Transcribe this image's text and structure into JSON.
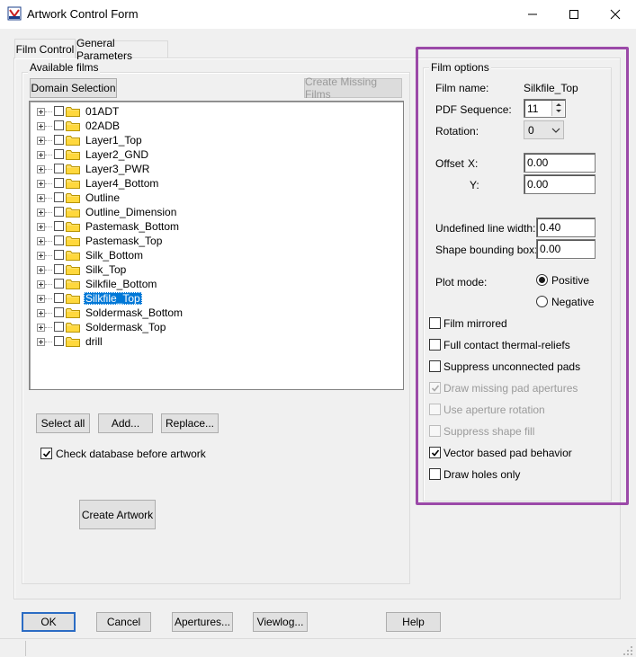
{
  "window": {
    "title": "Artwork Control Form",
    "accent_color": "#0078d7",
    "highlight_color": "#9b49a8"
  },
  "tabs": [
    {
      "label": "Film Control",
      "active": true
    },
    {
      "label": "General Parameters",
      "active": false
    }
  ],
  "available_films": {
    "group_label": "Available films",
    "domain_selection_label": "Domain Selection",
    "create_missing_films_label": "Create Missing Films",
    "films": [
      {
        "name": "01ADT",
        "selected": false
      },
      {
        "name": "02ADB",
        "selected": false
      },
      {
        "name": "Layer1_Top",
        "selected": false
      },
      {
        "name": "Layer2_GND",
        "selected": false
      },
      {
        "name": "Layer3_PWR",
        "selected": false
      },
      {
        "name": "Layer4_Bottom",
        "selected": false
      },
      {
        "name": "Outline",
        "selected": false
      },
      {
        "name": "Outline_Dimension",
        "selected": false
      },
      {
        "name": "Pastemask_Bottom",
        "selected": false
      },
      {
        "name": "Pastemask_Top",
        "selected": false
      },
      {
        "name": "Silk_Bottom",
        "selected": false
      },
      {
        "name": "Silk_Top",
        "selected": false
      },
      {
        "name": "Silkfile_Bottom",
        "selected": false
      },
      {
        "name": "Silkfile_Top",
        "selected": true
      },
      {
        "name": "Soldermask_Bottom",
        "selected": false
      },
      {
        "name": "Soldermask_Top",
        "selected": false
      },
      {
        "name": "drill",
        "selected": false
      }
    ],
    "select_all_label": "Select all",
    "add_label": "Add...",
    "replace_label": "Replace...",
    "check_database_label": "Check database before artwork",
    "check_database_checked": true,
    "create_artwork_label": "Create Artwork"
  },
  "film_options": {
    "group_label": "Film options",
    "film_name_label": "Film name:",
    "film_name_value": "Silkfile_Top",
    "pdf_sequence_label": "PDF Sequence:",
    "pdf_sequence_value": "11",
    "rotation_label": "Rotation:",
    "rotation_value": "0",
    "offset_label": "Offset",
    "offset_x_label": "X:",
    "offset_x_value": "0.00",
    "offset_y_label": "Y:",
    "offset_y_value": "0.00",
    "undefined_line_width_label": "Undefined line width:",
    "undefined_line_width_value": "0.40",
    "shape_bounding_box_label": "Shape bounding box:",
    "shape_bounding_box_value": "0.00",
    "plot_mode_label": "Plot mode:",
    "plot_mode_positive_label": "Positive",
    "plot_mode_negative_label": "Negative",
    "plot_mode_value": "Positive",
    "options": [
      {
        "label": "Film mirrored",
        "checked": false,
        "enabled": true
      },
      {
        "label": "Full contact thermal-reliefs",
        "checked": false,
        "enabled": true
      },
      {
        "label": "Suppress unconnected pads",
        "checked": false,
        "enabled": true
      },
      {
        "label": "Draw missing pad apertures",
        "checked": true,
        "enabled": false
      },
      {
        "label": "Use aperture rotation",
        "checked": false,
        "enabled": false
      },
      {
        "label": "Suppress shape fill",
        "checked": false,
        "enabled": false
      },
      {
        "label": "Vector based pad behavior",
        "checked": true,
        "enabled": true
      },
      {
        "label": "Draw holes only",
        "checked": false,
        "enabled": true
      }
    ]
  },
  "footer": {
    "ok_label": "OK",
    "cancel_label": "Cancel",
    "apertures_label": "Apertures...",
    "viewlog_label": "Viewlog...",
    "help_label": "Help"
  }
}
